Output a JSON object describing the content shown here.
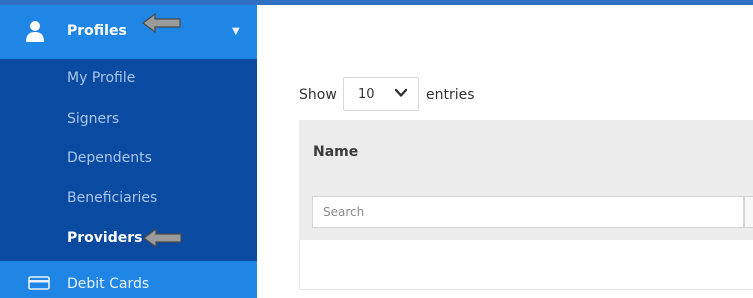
{
  "sidebar": {
    "profiles": {
      "label": "Profiles",
      "icon": "user-icon",
      "expanded": true
    },
    "submenu": [
      {
        "label": "My Profile",
        "active": false
      },
      {
        "label": "Signers",
        "active": false
      },
      {
        "label": "Dependents",
        "active": false
      },
      {
        "label": "Beneficiaries",
        "active": false
      },
      {
        "label": "Providers",
        "active": true
      }
    ],
    "debit_cards": {
      "label": "Debit Cards",
      "icon": "credit-card-icon"
    }
  },
  "main": {
    "show_label": "Show",
    "entries_select": {
      "value": "10"
    },
    "entries_label": "entries",
    "table": {
      "columns": [
        {
          "header": "Name",
          "filter_placeholder": "Search"
        }
      ]
    }
  },
  "colors": {
    "sidebar_bg": "#0a4aa0",
    "sidebar_active_bg": "#1f86e6",
    "annotation_arrow": "#9b9b9b"
  }
}
